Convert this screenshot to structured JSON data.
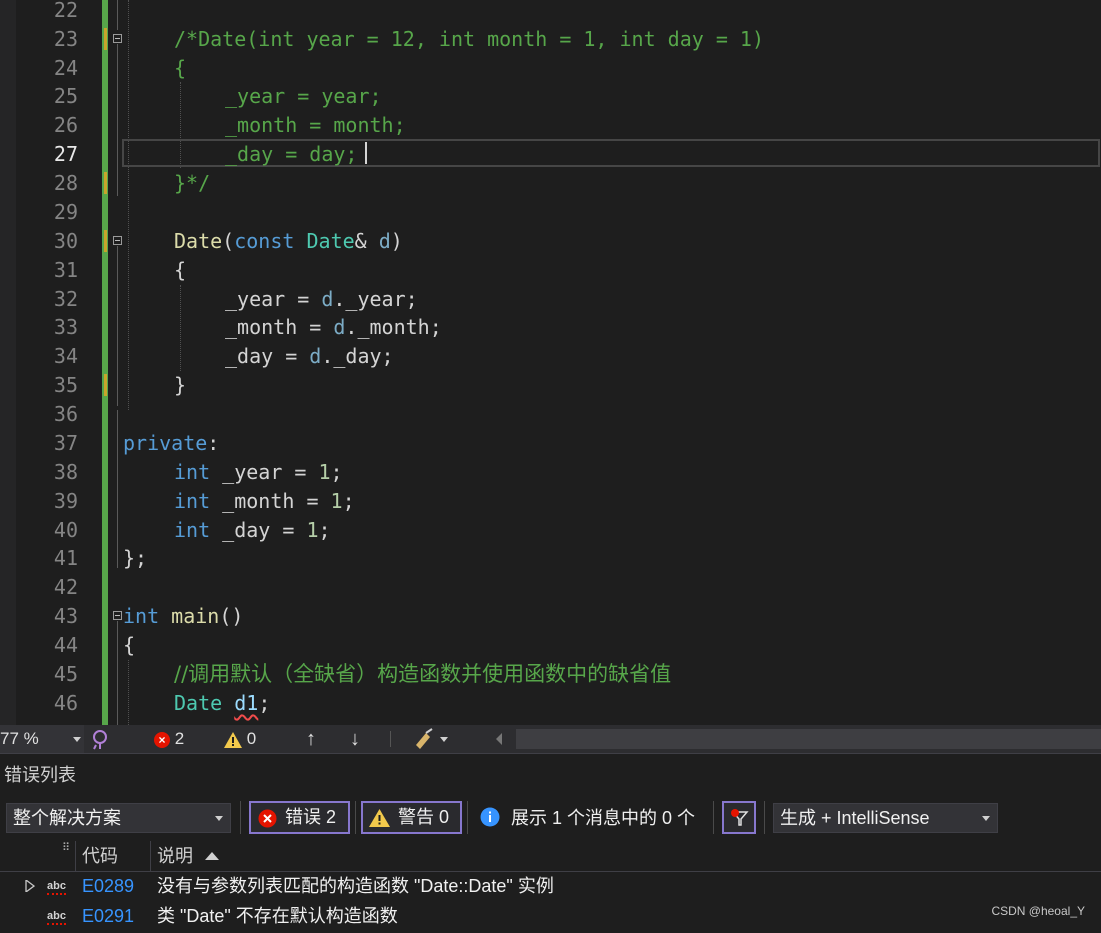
{
  "editor": {
    "line_numbers": [
      "22",
      "23",
      "24",
      "25",
      "26",
      "27",
      "28",
      "29",
      "30",
      "31",
      "32",
      "33",
      "34",
      "35",
      "36",
      "37",
      "38",
      "39",
      "40",
      "41",
      "42",
      "43",
      "44",
      "45",
      "46"
    ],
    "current_line": "27",
    "lines": {
      "l23": "/*Date(int year = 12, int month = 1, int day = 1)",
      "l24": "{",
      "l25": "_year = year;",
      "l26": "_month = month;",
      "l27": "_day = day;",
      "l28": "}*/",
      "l30_name": "Date",
      "l30_p1": "(",
      "l30_const": "const",
      "l30_type": "Date",
      "l30_rest": "& ",
      "l30_param": "d",
      "l30_close": ")",
      "l31": "{",
      "l32_a": "_year = ",
      "l32_d": "d",
      "l32_b": "._year;",
      "l33_a": "_month = ",
      "l33_d": "d",
      "l33_b": "._month;",
      "l34_a": "_day = ",
      "l34_d": "d",
      "l34_b": "._day;",
      "l35": "}",
      "l37_kw": "private",
      "l37_colon": ":",
      "l38_kw": "int",
      "l38_rest": " _year = ",
      "l38_num": "1",
      "l38_end": ";",
      "l39_kw": "int",
      "l39_rest": " _month = ",
      "l39_num": "1",
      "l39_end": ";",
      "l40_kw": "int",
      "l40_rest": " _day = ",
      "l40_num": "1",
      "l40_end": ";",
      "l41": "};",
      "l43_kw": "int",
      "l43_fn": "main",
      "l43_rest": "()",
      "l44": "{",
      "l45": "//调用默认（全缺省）构造函数并使用函数中的缺省值",
      "l46_type": "Date",
      "l46_var": "d1",
      "l46_end": ";"
    }
  },
  "statusbar": {
    "zoom": "77 %",
    "error_count": "2",
    "warning_count": "0"
  },
  "error_list": {
    "title": "错误列表",
    "scope": "整个解决方案",
    "errors_button": "错误 2",
    "warnings_button": "警告 0",
    "info_text": "展示 1 个消息中的 0 个",
    "source_filter": "生成 + IntelliSense",
    "col_code": "代码",
    "col_desc": "说明",
    "rows": [
      {
        "code": "E0289",
        "desc": "没有与参数列表匹配的构造函数 \"Date::Date\" 实例"
      },
      {
        "code": "E0291",
        "desc": "类 \"Date\" 不存在默认构造函数"
      }
    ],
    "abc_label": "abc"
  },
  "watermark": "CSDN @heoal_Y",
  "colors": {
    "background": "#1e1e1e",
    "keyword": "#569cd6",
    "type": "#4ec9b0",
    "function": "#dcdcaa",
    "number": "#b5cea8",
    "comment": "#57a64a",
    "change_bar": "#57a64a",
    "link": "#3794ff",
    "error": "#e51400",
    "filter_border": "#8777ce"
  }
}
